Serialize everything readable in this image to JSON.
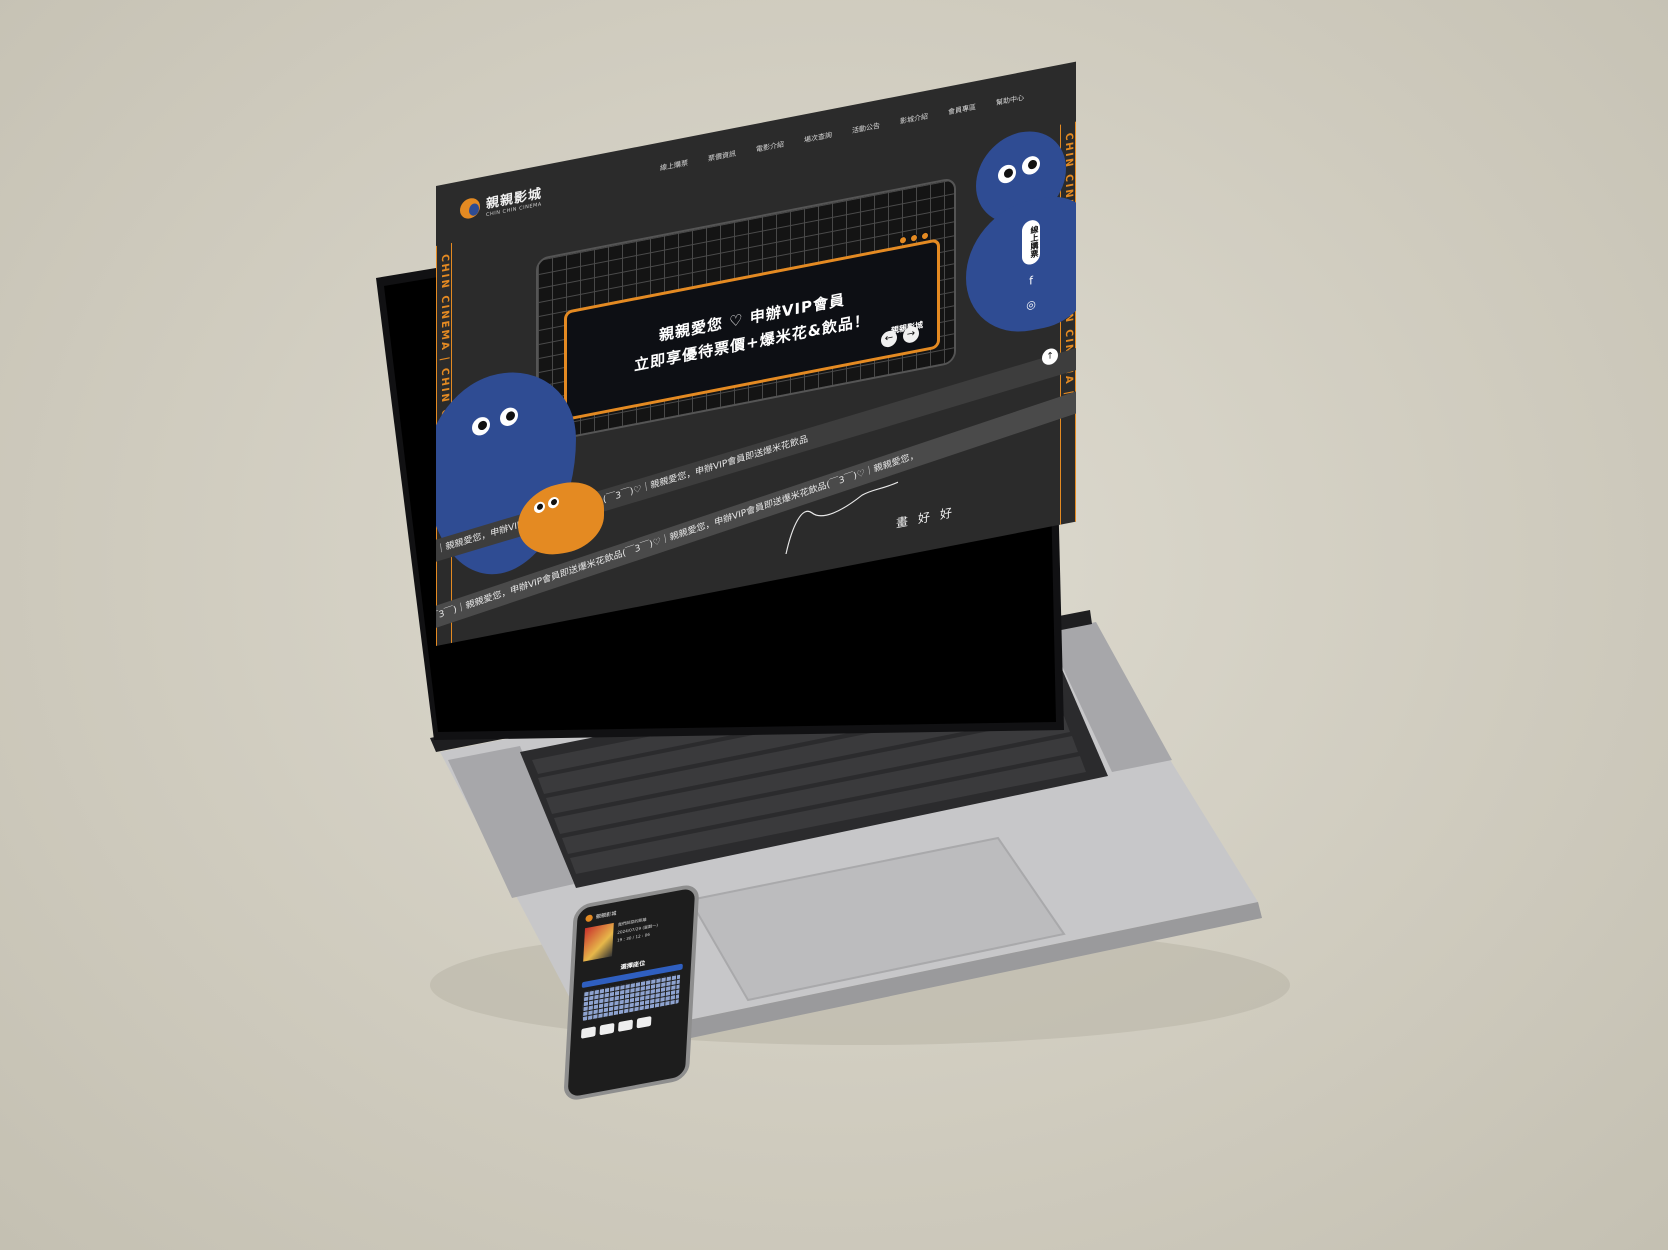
{
  "site": {
    "logo_title": "親親影城",
    "logo_sub": "CHIN CHIN CINEMA",
    "menu": [
      "線上購票",
      "票價資訊",
      "電影介紹",
      "場次查詢",
      "活動公告",
      "影城介紹",
      "會員專區",
      "幫助中心"
    ],
    "side_text": "CHIN CINEMA  |  CHIN CHIN CINEMA  |",
    "banner": {
      "line1": "親親愛您 ♡ 申辦VIP會員",
      "line2": "立即享優待票價+爆米花&飲品！",
      "logo": "親親影城"
    },
    "ribbon_text": "花飲品(￣3￣)｜親親愛您，申辦VIP會員即送爆米花飲品(￣3￣)♡｜親親愛您，申辦VIP會員即送爆米花飲品(￣3￣)♡｜親親愛您，",
    "ribbon_text_2": "(￣3￣)♡｜親親愛您，申辦VIP會員即送爆米花飲品(￣3￣)♡｜親親愛您，申辦VIP會員即送爆米花飲品",
    "sign_text": "畫好好",
    "buy_button": "線上購票",
    "social": [
      "f",
      "◎"
    ],
    "top_button": "↑",
    "prev": "←",
    "next": "→"
  },
  "phone": {
    "logo": "親親影城",
    "movie_lines": [
      "我們與惡的距離",
      "2024/07/29 (星期一)",
      "19 : 30 / 12 : 06"
    ],
    "section_title": "選擇座位"
  },
  "colors": {
    "orange": "#e48a22",
    "blue": "#2f4c93",
    "screen_bg": "#2b2b2b"
  }
}
